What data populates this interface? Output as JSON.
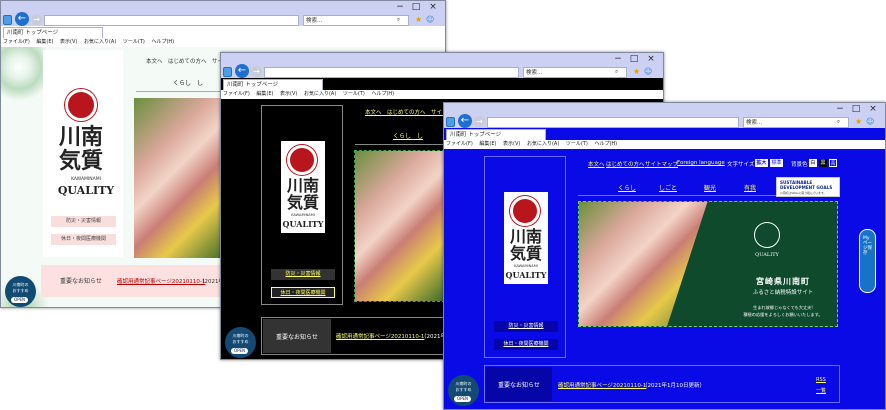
{
  "browser": {
    "tab_title": "川南町 トップページ",
    "search_placeholder": "検索...",
    "menu": [
      "ファイル(F)",
      "編集(E)",
      "表示(V)",
      "お気に入り(A)",
      "ツール(T)",
      "ヘルプ(H)"
    ],
    "search_glyph": "⌕",
    "toolbar_glyphs": [
      "★",
      "☺"
    ],
    "back_glyph": "←",
    "forward_glyph": "→",
    "tab_close_glyph": "×",
    "window_controls": [
      "−",
      "□",
      "×"
    ]
  },
  "site": {
    "header_links": [
      "本文へ",
      "はじめての方へ",
      "サイトマップ",
      "Foreign language"
    ],
    "font_size_label": "文字サイズ",
    "font_size_options": [
      "拡大",
      "標準"
    ],
    "bg_color_label": "背景色",
    "bg_color_options": [
      "白",
      "黒",
      "青"
    ],
    "main_nav": [
      "くらし",
      "しごと",
      "観光",
      "有我"
    ],
    "logo_title": "川南気質",
    "logo_roman": "KAWAMINAMI",
    "logo_quality": "QUALITY",
    "side_buttons": [
      "防災・災害情報",
      "休日・夜間医療機関"
    ],
    "notice_label": "重要なお知らせ",
    "notice_link": "確認用通常記事ページ20210110-1",
    "notice_date": "（2021年1月10日更新）",
    "rss": [
      "RSS",
      "一覧"
    ],
    "recommend_line1": "川南町の",
    "recommend_line2": "おすすめ",
    "recommend_open": "OPEN",
    "sdgs": "SUSTAINABLE DEVELOPMENT GOALS",
    "sdgs_sub": "川南町はSDGsに取り組んでいます。",
    "mypage": "My ページ保存",
    "hero_town": "宮崎県川南町",
    "hero_subtitle": "ふるさと納税特設サイト",
    "hero_caption1": "生まれ故郷じゃなくても大丈夫!",
    "hero_caption2": "積極の応援をよろしくお願いいたします。",
    "hero_partials": {
      "white_header": "本文へ　はじめての方へ　サイトマ",
      "white_nav": "くらし　し",
      "black_header": "本文へ　はじめての方へ　サイトマ",
      "black_nav": "くらし　し",
      "white_notice_date": "（2021年",
      "black_notice_date": "（2021年"
    }
  },
  "colors": {
    "browser_chrome": "#ccd1f4",
    "white_theme_bg": "#ffffff",
    "black_theme_bg": "#000000",
    "blue_theme_bg": "#0a0ae6",
    "seal_red": "#b9151c",
    "hero_green": "#0e4a2b",
    "link_yellow": "#ffff66"
  }
}
